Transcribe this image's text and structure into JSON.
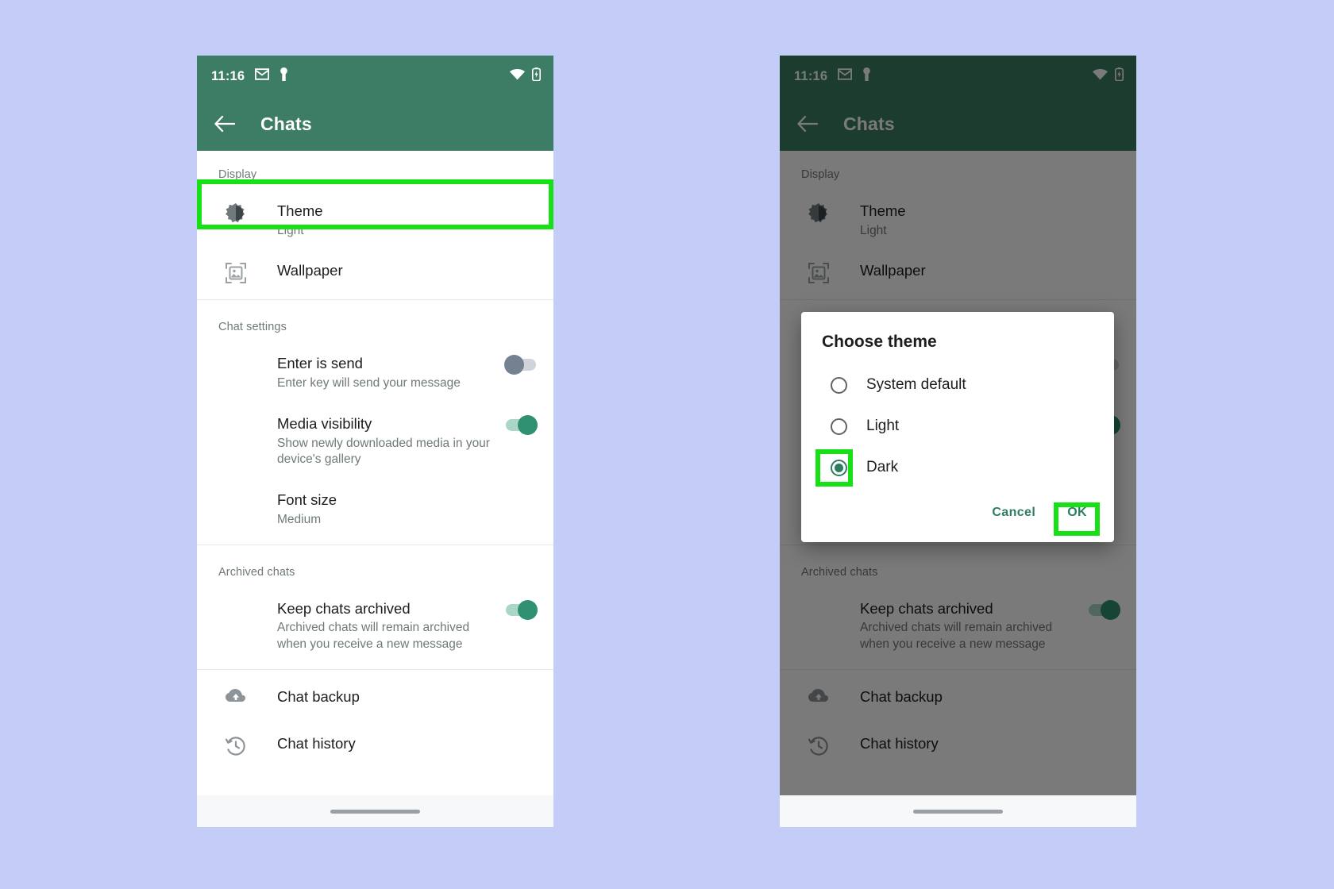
{
  "page": {
    "background_color": "#c3cdf7",
    "highlight_color": "#17e017",
    "brand_green": "#3d7d65"
  },
  "status_bar": {
    "time": "11:16",
    "icons": [
      "gmail-icon",
      "vpn-key-icon",
      "wifi-icon",
      "battery-icon"
    ]
  },
  "app_bar": {
    "back": "back-arrow-icon",
    "title": "Chats"
  },
  "sections": [
    {
      "label": "Display",
      "rows": [
        {
          "icon": "brightness-icon",
          "title": "Theme",
          "subtitle": "Light"
        },
        {
          "icon": "wallpaper-icon",
          "title": "Wallpaper",
          "subtitle": ""
        }
      ]
    },
    {
      "label": "Chat settings",
      "rows": [
        {
          "icon": "",
          "title": "Enter is send",
          "subtitle": "Enter key will send your message",
          "toggle": "off"
        },
        {
          "icon": "",
          "title": "Media visibility",
          "subtitle": "Show newly downloaded media in your device's gallery",
          "toggle": "on"
        },
        {
          "icon": "",
          "title": "Font size",
          "subtitle": "Medium"
        }
      ]
    },
    {
      "label": "Archived chats",
      "rows": [
        {
          "icon": "",
          "title": "Keep chats archived",
          "subtitle": "Archived chats will remain archived when you receive a new message",
          "toggle": "on"
        }
      ]
    },
    {
      "label": "",
      "rows": [
        {
          "icon": "cloud-upload-icon",
          "title": "Chat backup",
          "subtitle": ""
        },
        {
          "icon": "history-clock-icon",
          "title": "Chat history",
          "subtitle": ""
        }
      ]
    }
  ],
  "dialog": {
    "title": "Choose theme",
    "options": [
      {
        "label": "System default",
        "selected": false
      },
      {
        "label": "Light",
        "selected": false
      },
      {
        "label": "Dark",
        "selected": true
      }
    ],
    "cancel_label": "Cancel",
    "ok_label": "OK"
  }
}
